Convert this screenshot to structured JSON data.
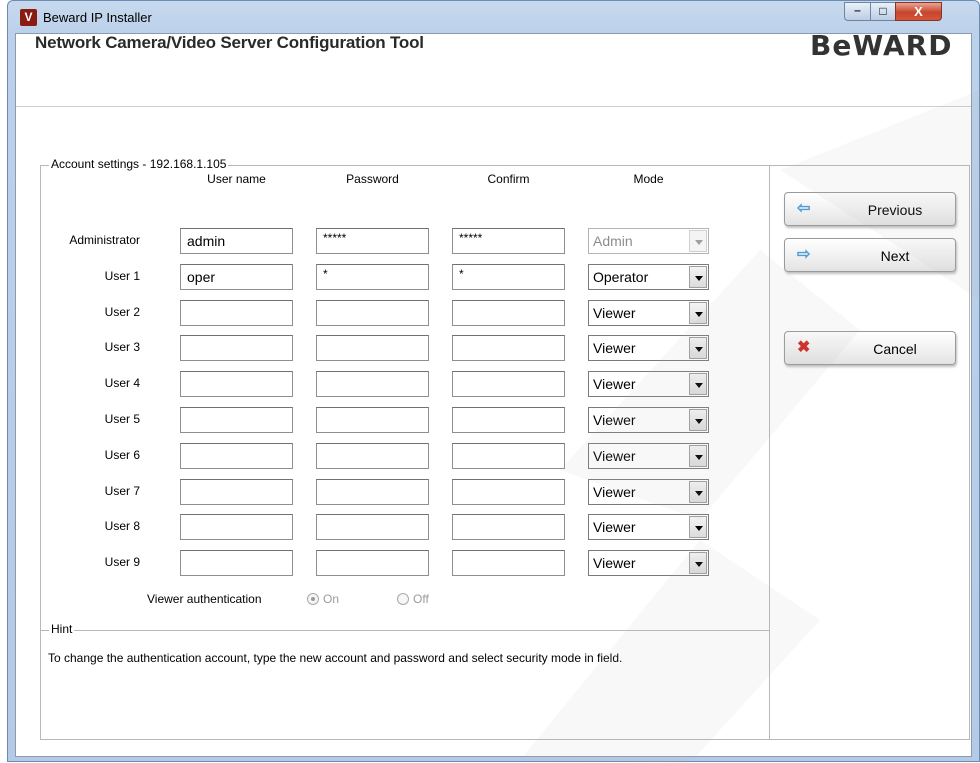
{
  "window": {
    "title": "Beward IP Installer",
    "minimize_glyph": "–",
    "maximize_glyph": "□",
    "close_glyph": "X"
  },
  "header": {
    "title": "Network Camera/Video Server Configuration Tool",
    "brand": "BeWARD"
  },
  "account_settings": {
    "legend": "Account settings - 192.168.1.105",
    "columns": [
      "User name",
      "Password",
      "Confirm",
      "Mode"
    ],
    "rows": [
      {
        "label": "Administrator",
        "username": "admin",
        "password": "*****",
        "confirm": "*****",
        "mode": "Admin",
        "mode_disabled": true
      },
      {
        "label": "User 1",
        "username": "oper",
        "password": "*",
        "confirm": "*",
        "mode": "Operator",
        "mode_disabled": false
      },
      {
        "label": "User 2",
        "username": "",
        "password": "",
        "confirm": "",
        "mode": "Viewer",
        "mode_disabled": false
      },
      {
        "label": "User 3",
        "username": "",
        "password": "",
        "confirm": "",
        "mode": "Viewer",
        "mode_disabled": false
      },
      {
        "label": "User 4",
        "username": "",
        "password": "",
        "confirm": "",
        "mode": "Viewer",
        "mode_disabled": false
      },
      {
        "label": "User 5",
        "username": "",
        "password": "",
        "confirm": "",
        "mode": "Viewer",
        "mode_disabled": false
      },
      {
        "label": "User 6",
        "username": "",
        "password": "",
        "confirm": "",
        "mode": "Viewer",
        "mode_disabled": false
      },
      {
        "label": "User 7",
        "username": "",
        "password": "",
        "confirm": "",
        "mode": "Viewer",
        "mode_disabled": false
      },
      {
        "label": "User 8",
        "username": "",
        "password": "",
        "confirm": "",
        "mode": "Viewer",
        "mode_disabled": false
      },
      {
        "label": "User 9",
        "username": "",
        "password": "",
        "confirm": "",
        "mode": "Viewer",
        "mode_disabled": false
      }
    ],
    "viewer_auth": {
      "label": "Viewer authentication",
      "on_label": "On",
      "off_label": "Off",
      "selected": "On"
    }
  },
  "hint": {
    "legend": "Hint",
    "text": "To change the authentication account, type the new account and password and select security mode in field."
  },
  "nav": {
    "previous": "Previous",
    "next": "Next",
    "cancel": "Cancel"
  },
  "colors": {
    "titlebar": "#bcd1ea",
    "close_button": "#c7452d",
    "arrow_icon": "#4f9bd6",
    "cancel_icon": "#d0281e"
  }
}
